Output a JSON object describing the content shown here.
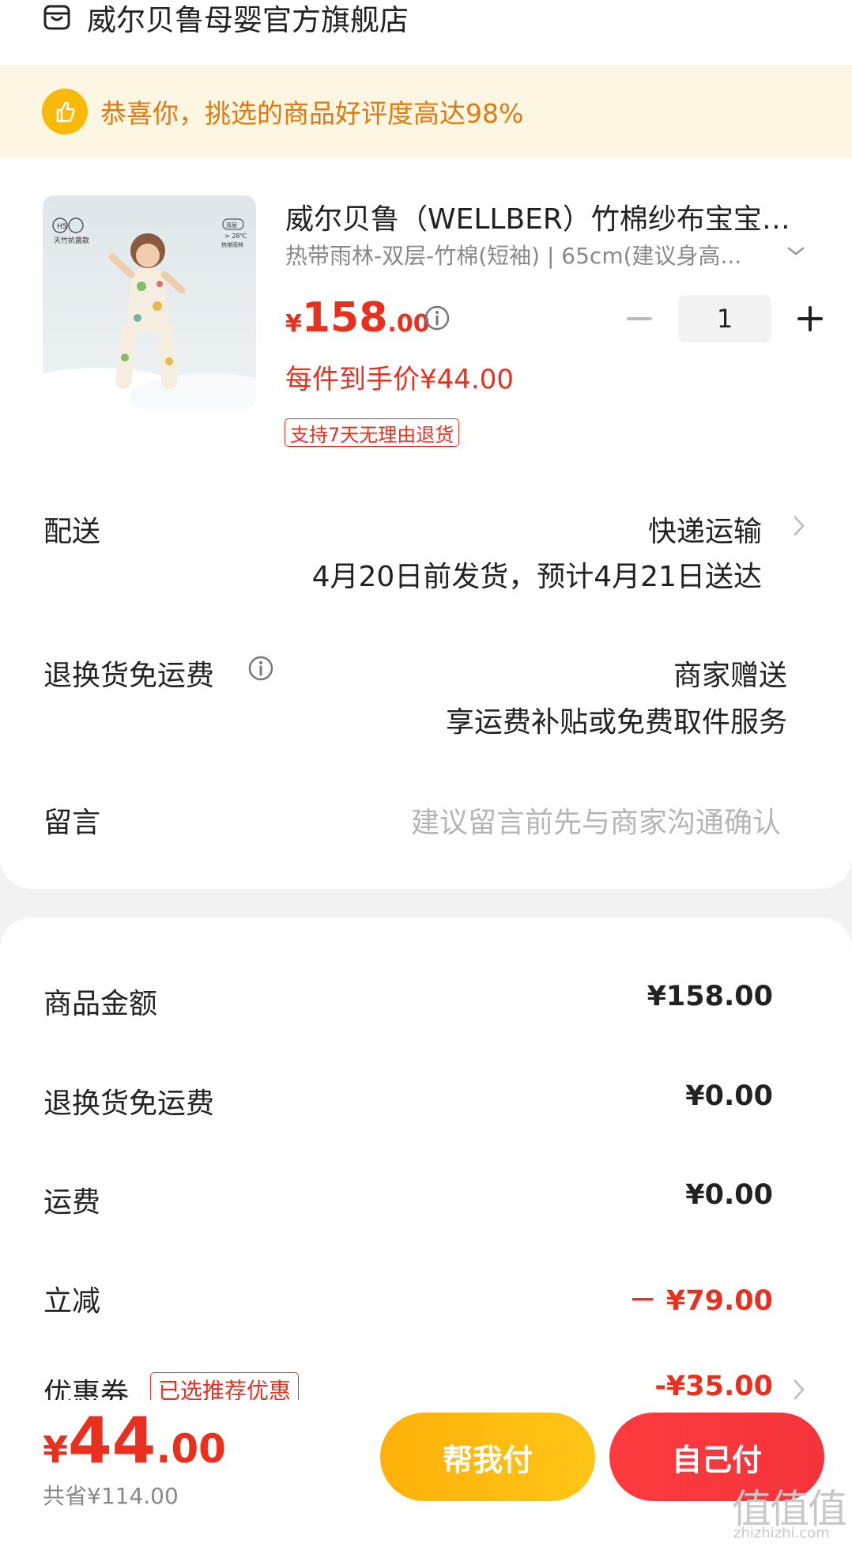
{
  "store": {
    "name": "威尔贝鲁母婴官方旗舰店",
    "icon": "shop-icon"
  },
  "banner": {
    "text": "恭喜你，挑选的商品好评度高达98%",
    "icon": "thumbs-up-icon",
    "color": "#e07a10",
    "bg": "#fdf6e2"
  },
  "product": {
    "title": "威尔贝鲁（WELLBER）竹棉纱布宝宝睡袋",
    "spec": "热带雨林-双层-竹棉(短袖) | 65cm(建议身高...",
    "image_labels": {
      "badge_left": "H5",
      "text_left": "天竹抗菌款",
      "badge_right": "双层",
      "text_right_1": "> 28℃",
      "text_right_2": "热带雨林"
    },
    "price": {
      "currency": "¥",
      "integer": "158",
      "decimal": ".00"
    },
    "quantity": "1",
    "unit_price_label": "每件到手价¥44.00",
    "return_tag": "支持7天无理由退货"
  },
  "delivery": {
    "label": "配送",
    "method": "快递运输",
    "estimate": "4月20日前发货，预计4月21日送达"
  },
  "return_shipping": {
    "label": "退换货免运费",
    "value": "商家赠送",
    "desc": "享运费补贴或免费取件服务"
  },
  "message": {
    "label": "留言",
    "placeholder": "建议留言前先与商家沟通确认"
  },
  "summary": {
    "goods": {
      "label": "商品金额",
      "value": "¥158.00"
    },
    "return_fee": {
      "label": "退换货免运费",
      "value": "¥0.00"
    },
    "shipping": {
      "label": "运费",
      "value": "¥0.00"
    },
    "discount": {
      "label": "立减",
      "value": "－ ¥79.00"
    },
    "coupon": {
      "label": "优惠券",
      "tag": "已选推荐优惠",
      "value": "-¥35.00"
    }
  },
  "footer": {
    "total": {
      "currency": "¥",
      "integer": "44",
      "decimal": ".00"
    },
    "saved": "共省¥114.00",
    "help_pay": "帮我付",
    "self_pay": "自己付"
  },
  "watermark": {
    "glyphs": "值值值",
    "url": "zhizhizhi.com"
  },
  "colors": {
    "accent_red": "#e9301f",
    "yellow": "#ffb10a",
    "red_button": "#fd3b3f"
  }
}
